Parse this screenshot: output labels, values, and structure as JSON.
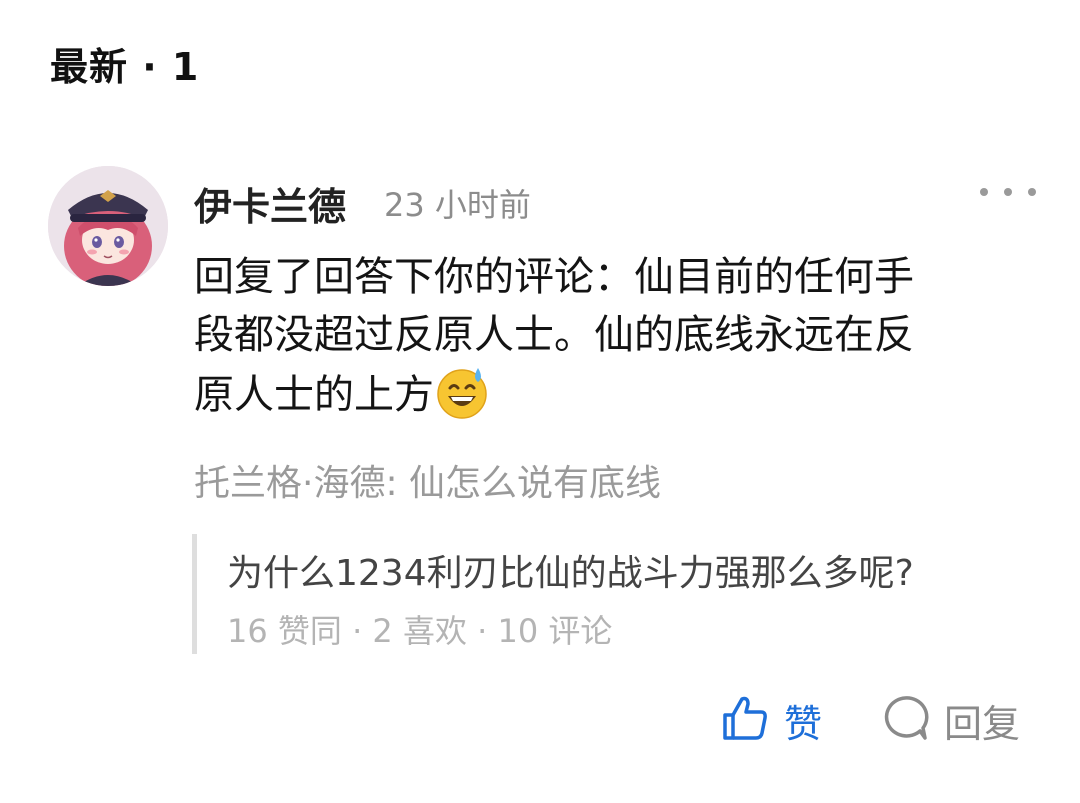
{
  "section": {
    "title": "最新 · 1"
  },
  "comment": {
    "author": "伊卡兰德",
    "time": "23 小时前",
    "body_line1": "回复了回答下你的评论：仙目前的任何手",
    "body_line2": "段都没超过反原人士。仙的底线永远在反",
    "body_line3": "原人士的上方",
    "emoji_icon": "grinning-sweat-emoji",
    "reply_to": "托兰格·海德: 仙怎么说有底线",
    "quote": {
      "question": "为什么1234利刃比仙的战斗力强那么多呢?",
      "stats": "16 赞同 · 2 喜欢 · 10 评论"
    }
  },
  "actions": {
    "like_label": "赞",
    "reply_label": "回复"
  },
  "colors": {
    "accent": "#1e6fd9",
    "muted": "#9a9a9a",
    "quote_border": "#dedede"
  }
}
